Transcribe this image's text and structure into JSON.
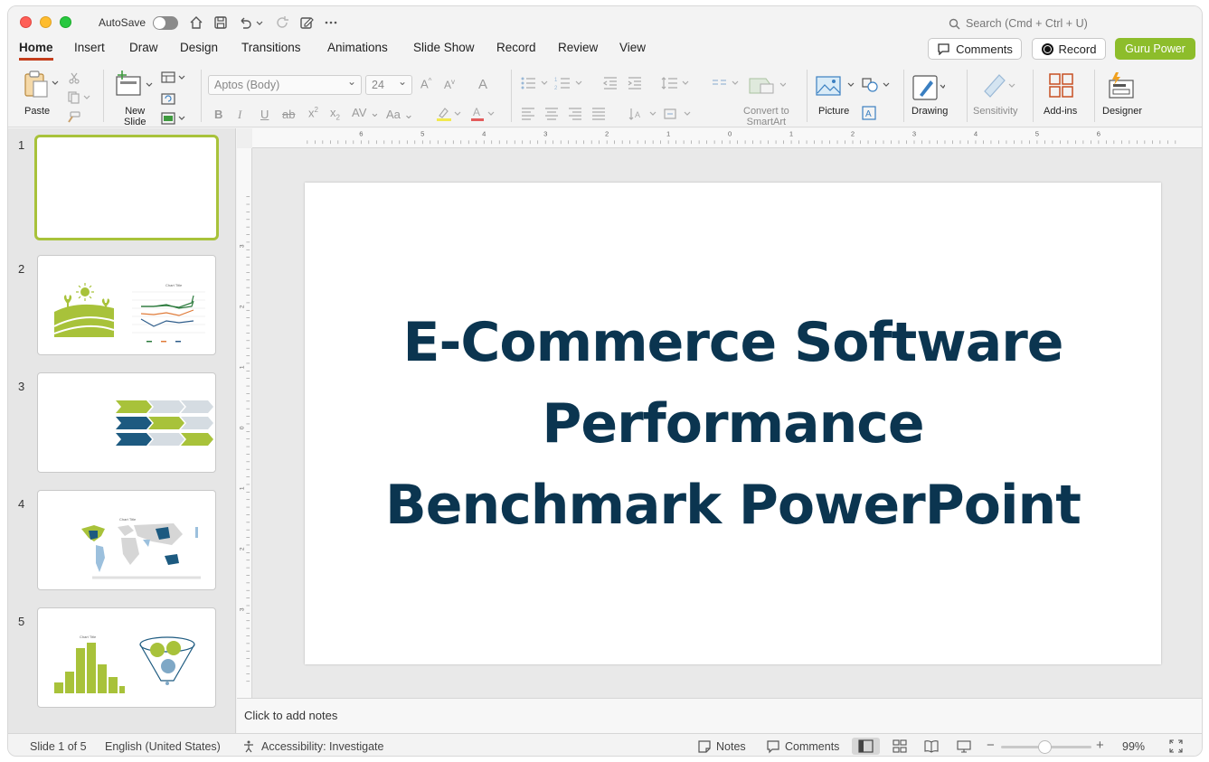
{
  "titlebar": {
    "autosave_label": "AutoSave",
    "search_placeholder": "Search (Cmd + Ctrl + U)"
  },
  "tabs": [
    "Home",
    "Insert",
    "Draw",
    "Design",
    "Transitions",
    "Animations",
    "Slide Show",
    "Record",
    "Review",
    "View"
  ],
  "active_tab": "Home",
  "header_buttons": {
    "comments": "Comments",
    "record": "Record",
    "guru": "Guru Power"
  },
  "ribbon": {
    "paste": "Paste",
    "new_slide_line1": "New",
    "new_slide_line2": "Slide",
    "font_name": "Aptos (Body)",
    "font_size": "24",
    "convert_line1": "Convert to",
    "convert_line2": "SmartArt",
    "picture": "Picture",
    "drawing": "Drawing",
    "sensitivity": "Sensitivity",
    "addins": "Add-ins",
    "designer": "Designer"
  },
  "thumbnails": [
    {
      "num": "1"
    },
    {
      "num": "2",
      "chart_title": "Chart Title"
    },
    {
      "num": "3"
    },
    {
      "num": "4",
      "chart_title": "Chart Title"
    },
    {
      "num": "5",
      "chart_title": "Chart Title"
    }
  ],
  "ruler_h_labels": [
    "6",
    "5",
    "4",
    "3",
    "2",
    "1",
    "0",
    "1",
    "2",
    "3",
    "4",
    "5",
    "6"
  ],
  "ruler_v_labels": [
    "3",
    "2",
    "1",
    "0",
    "1",
    "2",
    "3"
  ],
  "slide": {
    "title_line1": "E-Commerce Software",
    "title_line2": "Performance",
    "title_line3": "Benchmark PowerPoint"
  },
  "notes_placeholder": "Click to add notes",
  "status": {
    "slide_info": "Slide 1 of 5",
    "language": "English (United States)",
    "accessibility": "Accessibility: Investigate",
    "notes": "Notes",
    "comments": "Comments",
    "zoom": "99%"
  },
  "colors": {
    "accent_green": "#8dbd2b",
    "title_navy": "#0b3550",
    "tab_underline": "#c43e1c"
  }
}
